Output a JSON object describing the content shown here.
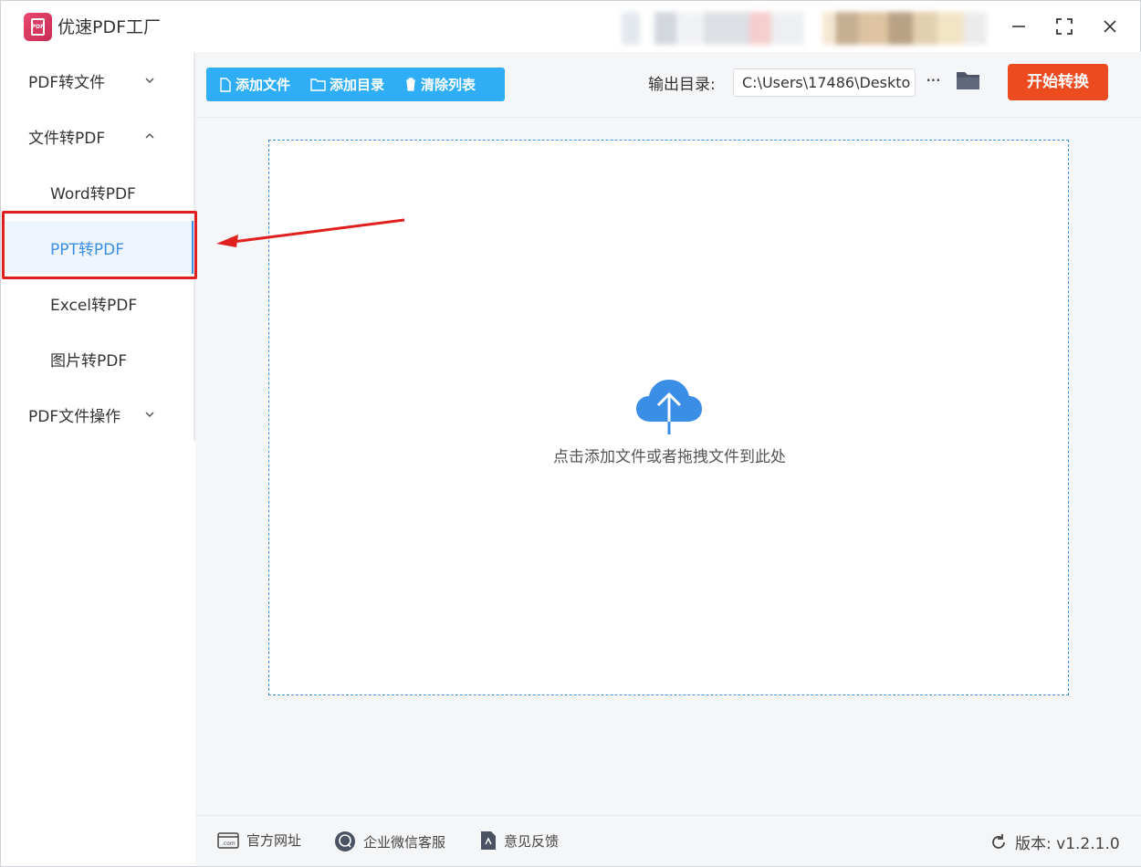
{
  "window": {
    "title": "优速PDF工厂",
    "controls": {
      "minimize": "—",
      "close": "✕"
    }
  },
  "sidebar": {
    "items": [
      {
        "label": "PDF转文件",
        "expanded": false
      },
      {
        "label": "文件转PDF",
        "expanded": true
      },
      {
        "label": "Word转PDF"
      },
      {
        "label": "PPT转PDF",
        "active": true
      },
      {
        "label": "Excel转PDF"
      },
      {
        "label": "图片转PDF"
      },
      {
        "label": "PDF文件操作",
        "expanded": false
      }
    ]
  },
  "toolbar": {
    "add_file": "添加文件",
    "add_dir": "添加目录",
    "clear_list": "清除列表",
    "output_label": "输出目录:",
    "output_path": "C:\\Users\\17486\\Deskto",
    "more": "···",
    "start": "开始转换"
  },
  "dropzone": {
    "text": "点击添加文件或者拖拽文件到此处"
  },
  "footer": {
    "website": "官方网址",
    "wechat": "企业微信客服",
    "feedback": "意见反馈",
    "version": "版本:  v1.2.1.0"
  },
  "colors": {
    "accent": "#3a8ee6",
    "toolbar_button": "#30aef5",
    "start_button": "#ec4a1f",
    "annotation": "#e0201e"
  }
}
